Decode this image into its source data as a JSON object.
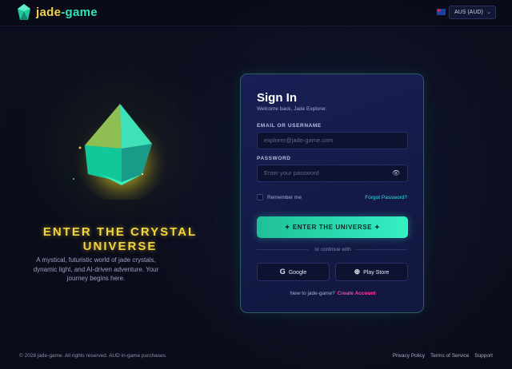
{
  "header": {
    "brand_part1": "jade",
    "brand_part2": "-game",
    "currency": "AUS (AUD)",
    "flag_icon": "australia-flag-icon"
  },
  "hero": {
    "title": "ENTER THE CRYSTAL UNIVERSE",
    "subtitle": "A mystical, futuristic world of jade crystals, dynamic light, and AI-driven adventure. Your journey begins here."
  },
  "signin": {
    "title": "Sign In",
    "welcome": "Welcome back, Jade Explorer.",
    "email_label": "EMAIL OR USERNAME",
    "email_placeholder": "explorer@jade-game.com",
    "password_label": "PASSWORD",
    "password_placeholder": "Enter your password",
    "remember_label": "Remember me",
    "forgot_label": "Forgot Password?",
    "submit_label": "✦ ENTER THE UNIVERSE ✦",
    "or_label": "or continue with",
    "google_label": "Google",
    "playstore_label": "Play Store",
    "new_to": "New to jade-game?",
    "create_label": "Create Account"
  },
  "footer": {
    "copyright": "© 2026 jade-game. All rights reserved. AUD in-game purchases.",
    "links": [
      "Privacy Policy",
      "Terms of Service",
      "Support"
    ]
  },
  "colors": {
    "accent": "#2ee6b6",
    "gold": "#f5d43c",
    "link": "#3dd9e8",
    "create": "#ff3fa4",
    "card_bg": "#161d4e"
  }
}
